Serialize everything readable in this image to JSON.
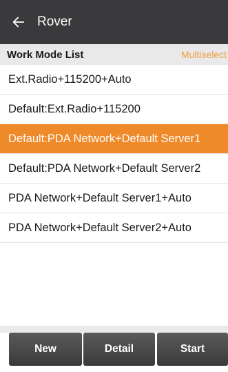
{
  "appbar": {
    "title": "Rover",
    "back_icon": "arrow-left"
  },
  "list_header": {
    "title": "Work Mode List",
    "multiselect_label": "Multiselect",
    "accent_color": "#f0a040"
  },
  "work_modes": [
    {
      "label": "Ext.Radio+115200+Auto",
      "selected": false
    },
    {
      "label": "Default:Ext.Radio+115200",
      "selected": false
    },
    {
      "label": "Default:PDA Network+Default Server1",
      "selected": true
    },
    {
      "label": "Default:PDA Network+Default Server2",
      "selected": false
    },
    {
      "label": "PDA Network+Default Server1+Auto",
      "selected": false
    },
    {
      "label": "PDA Network+Default Server2+Auto",
      "selected": false
    }
  ],
  "selected_color": "#ef8a2a",
  "footer": {
    "new_label": "New",
    "detail_label": "Detail",
    "start_label": "Start"
  }
}
